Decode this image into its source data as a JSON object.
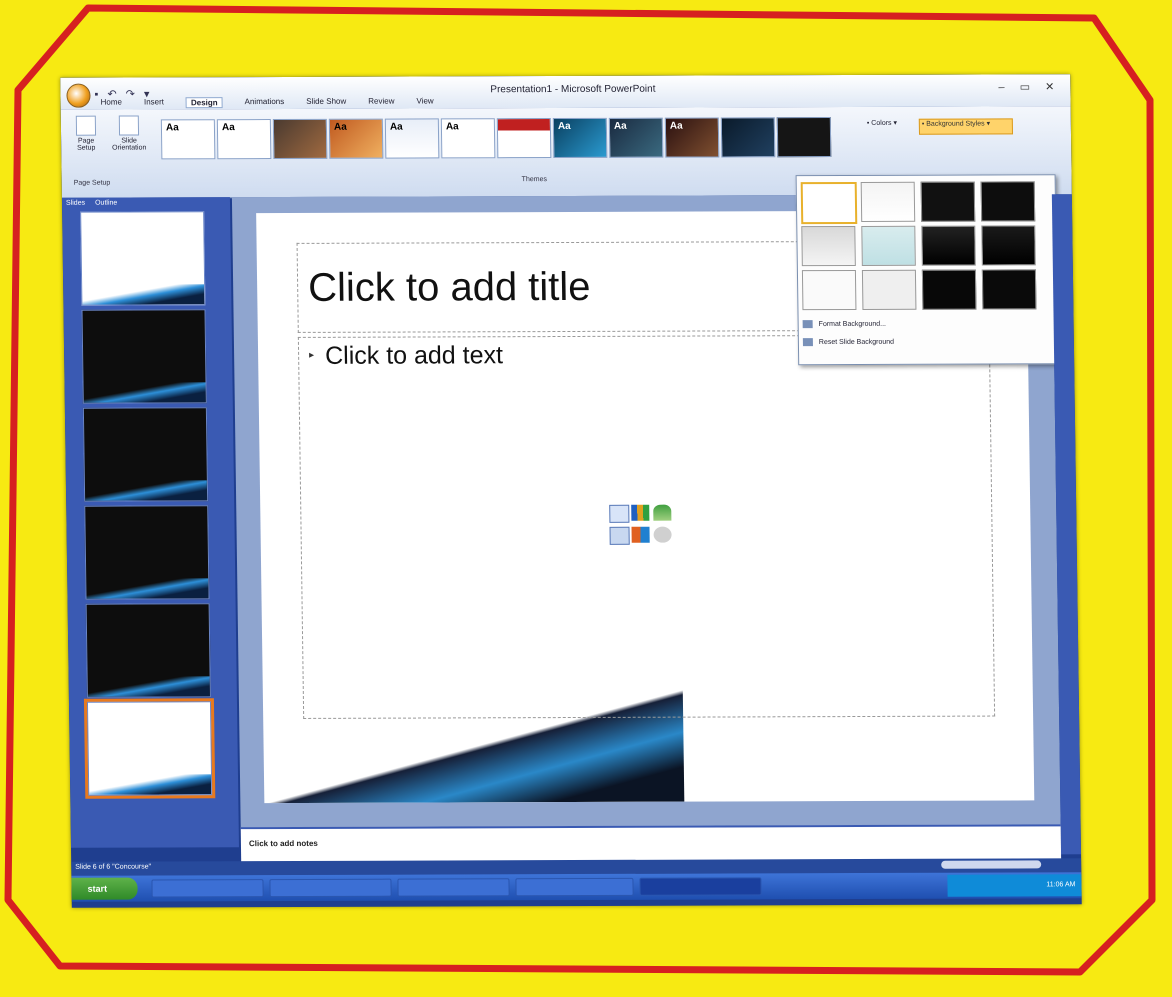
{
  "app": {
    "title": "Presentation1 - Microsoft PowerPoint",
    "quick_access": "▪ ↶ ↷ ▾",
    "window_controls": "– ▭ ✕"
  },
  "ribbon": {
    "tabs": [
      "Home",
      "Insert",
      "Design",
      "Animations",
      "Slide Show",
      "Review",
      "View"
    ],
    "active_tab": "Design",
    "page_setup_label": "Page Setup",
    "slide_orientation_label": "Slide Orientation",
    "page_setup_group": "Page Setup",
    "themes_group": "Themes",
    "theme_sample_text": "Aa",
    "colors_label": "Colors",
    "background_styles_label": "Background Styles"
  },
  "background_menu": {
    "format_background": "Format Background...",
    "reset_background": "Reset Slide Background"
  },
  "left_panel": {
    "tab_slides": "Slides",
    "tab_outline": "Outline",
    "thumbnail_count": 6
  },
  "slide": {
    "title_placeholder": "Click to add title",
    "text_placeholder": "Click to add text",
    "bullet": "▸"
  },
  "notes": {
    "placeholder": "Click to add notes"
  },
  "status": {
    "text": "Slide 6 of 6   \"Concourse\""
  },
  "taskbar": {
    "start": "start",
    "tasks": [],
    "clock": "11:06 AM"
  },
  "colors": {
    "page_background": "#f7ea12",
    "frame_border": "#d62020",
    "ribbon_blue": "#3a5ab3",
    "selection_orange": "#e87a1e"
  }
}
